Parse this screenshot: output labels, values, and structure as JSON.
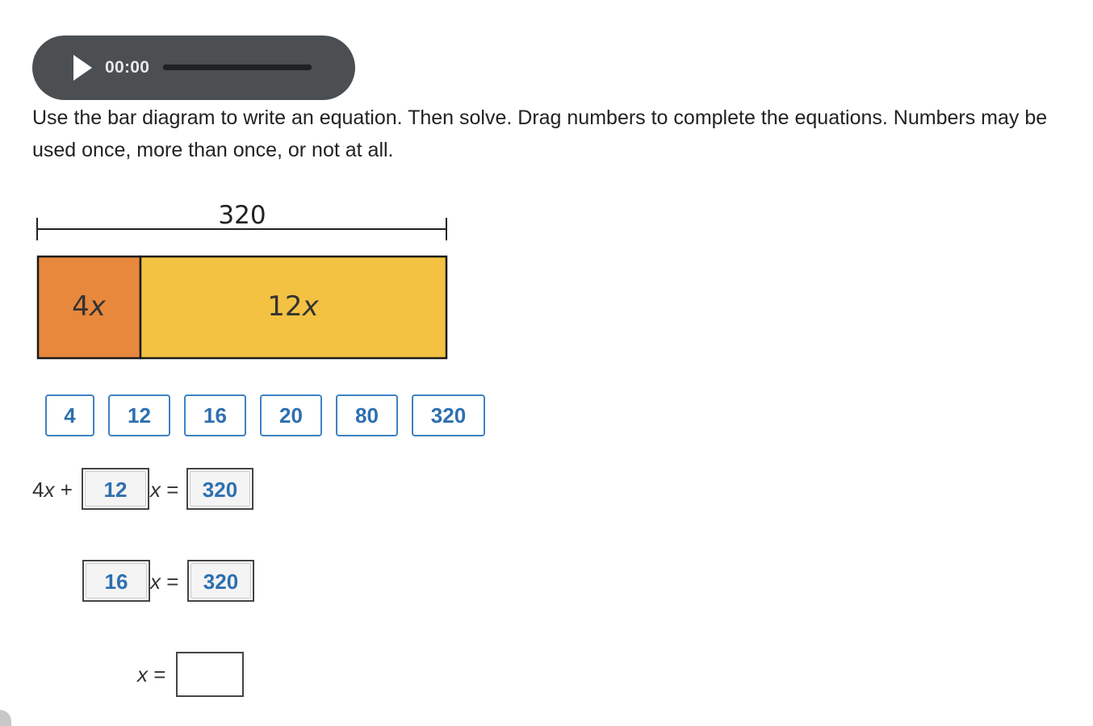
{
  "audio": {
    "time": "00:00",
    "play_icon": "play-icon"
  },
  "instructions": "Use the bar diagram to write an equation. Then solve. Drag numbers to complete the equations. Numbers may be used once, more than once, or not at all.",
  "diagram": {
    "total_label": "320",
    "left_segment": {
      "coef": "4",
      "var": "x",
      "color": "#e8883d"
    },
    "right_segment": {
      "coef": "12",
      "var": "x",
      "color": "#f3c242"
    }
  },
  "tiles": [
    "4",
    "12",
    "16",
    "20",
    "80",
    "320"
  ],
  "equations": {
    "eq1": {
      "prefix_coef": "4",
      "var": "x",
      "plus": "+",
      "slot1": "12",
      "equals": "=",
      "slot2": "320"
    },
    "eq2": {
      "slot1": "16",
      "var": "x",
      "equals": "=",
      "slot2": "320"
    },
    "eq3": {
      "var": "x",
      "equals": "=",
      "slot1": ""
    }
  },
  "colors": {
    "player_bg": "#4b4f52",
    "tile_border": "#3d82c4",
    "tile_text": "#2e6fb0"
  }
}
